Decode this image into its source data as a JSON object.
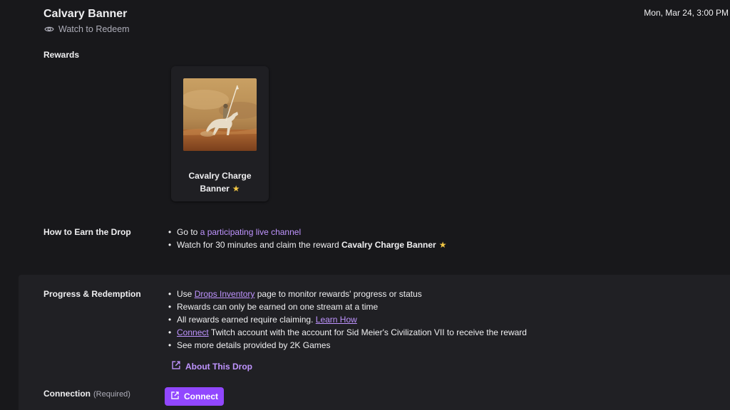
{
  "header": {
    "title": "Calvary Banner",
    "subtitle": "Watch to Redeem",
    "datetime": "Mon, Mar 24, 3:00 PM"
  },
  "rewards": {
    "label": "Rewards",
    "items": [
      {
        "name_line1": "Cavalry Charge",
        "name_line2": "Banner",
        "badge": "★"
      }
    ]
  },
  "how_to_earn": {
    "label": "How to Earn the Drop",
    "step1_prefix": "Go to ",
    "step1_link": "a participating live channel",
    "step2_prefix": "Watch for 30 minutes and claim the reward ",
    "step2_reward": "Cavalry Charge Banner",
    "step2_badge": "★"
  },
  "progress": {
    "label": "Progress & Redemption",
    "item1_prefix": "Use ",
    "item1_link": "Drops Inventory",
    "item1_suffix": " page to monitor rewards' progress or status",
    "item2": "Rewards can only be earned on one stream at a time",
    "item3_prefix": "All rewards earned require claiming. ",
    "item3_link": "Learn How",
    "item4_link": "Connect",
    "item4_suffix": " Twitch account with the account for Sid Meier's Civilization VII to receive the reward",
    "item5": "See more details provided by 2K Games",
    "about_link": "About This Drop"
  },
  "connection": {
    "label": "Connection",
    "required": "(Required)",
    "button_label": "Connect"
  },
  "colors": {
    "background": "#18181b",
    "panel": "#202024",
    "accent": "#9147ff",
    "link": "#bf94ff",
    "star": "#f2c744"
  }
}
